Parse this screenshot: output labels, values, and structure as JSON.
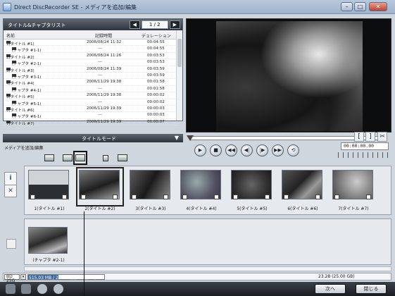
{
  "window": {
    "title": "Direct DiscRecorder SE - メディアを追加/編集",
    "min": "–",
    "max": "□",
    "close": "✕"
  },
  "list": {
    "title": "タイトル&チャプタリスト",
    "page": "1 / 2",
    "prev": "◀",
    "next": "▶",
    "columns": [
      "名前",
      "記録時間",
      "デュレーション"
    ],
    "rows": [
      {
        "name": "1(タイトル #1)",
        "time": "2006/08/24 11:32",
        "dur": "00:04:55",
        "child": false
      },
      {
        "name": "(チャプタ #1-1)",
        "time": "---",
        "dur": "00:04:55",
        "child": true
      },
      {
        "name": "2(タイトル #2)",
        "time": "2006/08/24 11:26",
        "dur": "00:03:53",
        "child": false
      },
      {
        "name": "(チャプタ #2-1)",
        "time": "---",
        "dur": "00:03:53",
        "child": true
      },
      {
        "name": "3(タイトル #3)",
        "time": "2006/08/24 11:39",
        "dur": "00:03:59",
        "child": false
      },
      {
        "name": "(チャプタ #3-1)",
        "time": "---",
        "dur": "00:03:59",
        "child": true
      },
      {
        "name": "4(タイトル #4)",
        "time": "2006/11/29 19:38",
        "dur": "00:01:58",
        "child": false
      },
      {
        "name": "(チャプタ #4-1)",
        "time": "---",
        "dur": "00:01:58",
        "child": true
      },
      {
        "name": "5(タイトル #5)",
        "time": "2006/11/29 19:38",
        "dur": "00:00:02",
        "child": false
      },
      {
        "name": "(チャプタ #5-1)",
        "time": "---",
        "dur": "00:00:02",
        "child": true
      },
      {
        "name": "6(タイトル #6)",
        "time": "2006/11/29 19:39",
        "dur": "00:00:03",
        "child": false
      },
      {
        "name": "(チャプタ #6-1)",
        "time": "---",
        "dur": "00:00:03",
        "child": true
      },
      {
        "name": "7(タイトル #7)",
        "time": "2006/11/29 19:39",
        "dur": "00:00:07",
        "child": false
      }
    ]
  },
  "mode": {
    "title": "タイトルモード",
    "arrow": "▼"
  },
  "media_label": "メディアを追加/編集",
  "toolbar_icons": [
    "add-video-icon",
    "split-icon",
    "select-title-icon",
    "lock-icon",
    "merge-icon"
  ],
  "player": {
    "buttons": [
      "▶",
      "■",
      "◀◀",
      "◀|",
      "|▶",
      "▶▶",
      "⟲"
    ],
    "timecode": "00:00:00.00",
    "mark_in": "[",
    "mark_out": "]",
    "cut": "✂"
  },
  "side": {
    "info": "i",
    "close": "✕"
  },
  "clips": [
    {
      "label": "1(タイトル #1)",
      "selected": false
    },
    {
      "label": "2(タイトル #2)",
      "selected": true
    },
    {
      "label": "3(タイトル #3)",
      "selected": false
    },
    {
      "label": "4(タイトル #4)",
      "selected": false
    },
    {
      "label": "5(タイトル #5)",
      "selected": false
    },
    {
      "label": "6(タイトル #6)",
      "selected": false
    },
    {
      "label": "7(タイトル #7)",
      "selected": false
    }
  ],
  "chapter": {
    "label": "(チャプタ #2-1)"
  },
  "status": {
    "disc": "BD 25G",
    "dropdown": "▾",
    "used": "515.03 MB / 2... 1 時間 37 分 4 秒",
    "used_fraction": 0.4,
    "total": "23.28 (25.00 GB)"
  },
  "footer": {
    "next": "次へ",
    "close": "閉じる"
  }
}
